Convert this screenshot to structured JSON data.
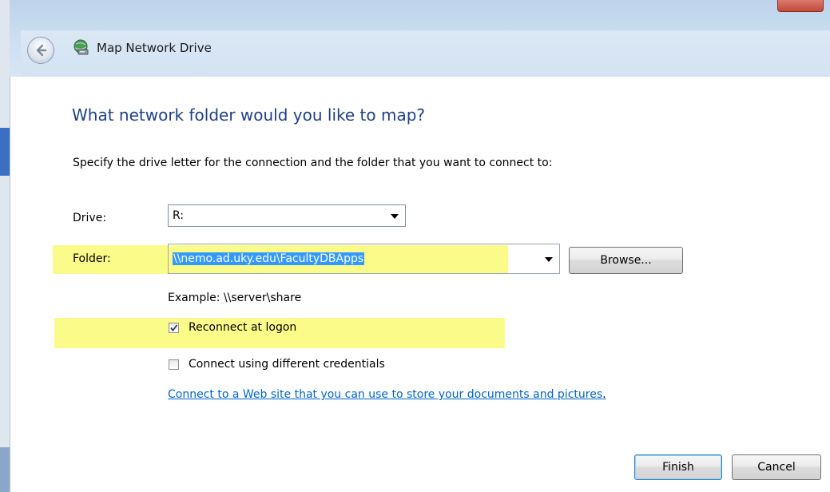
{
  "window": {
    "title": "Map Network Drive",
    "back_icon": "back-arrow-icon",
    "app_icon": "network-drive-icon"
  },
  "page": {
    "heading": "What network folder would you like to map?",
    "instruction": "Specify the drive letter for the connection and the folder that you want to connect to:"
  },
  "drive": {
    "label": "Drive:",
    "value": "R:"
  },
  "folder": {
    "label": "Folder:",
    "value": "\\\\nemo.ad.uky.edu\\FacultyDBApps",
    "browse_label": "Browse...",
    "example": "Example: \\\\server\\share"
  },
  "options": {
    "reconnect_label": "Reconnect at logon",
    "reconnect_checked": true,
    "credentials_label": "Connect using different credentials",
    "credentials_checked": false
  },
  "link": {
    "text": "Connect to a Web site that you can use to store your documents and pictures",
    "suffix": "."
  },
  "buttons": {
    "finish": "Finish",
    "cancel": "Cancel"
  },
  "colors": {
    "heading": "#1e3f8a",
    "highlight": "#fbfb8a",
    "selection": "#3399ff",
    "link": "#0066cc"
  }
}
